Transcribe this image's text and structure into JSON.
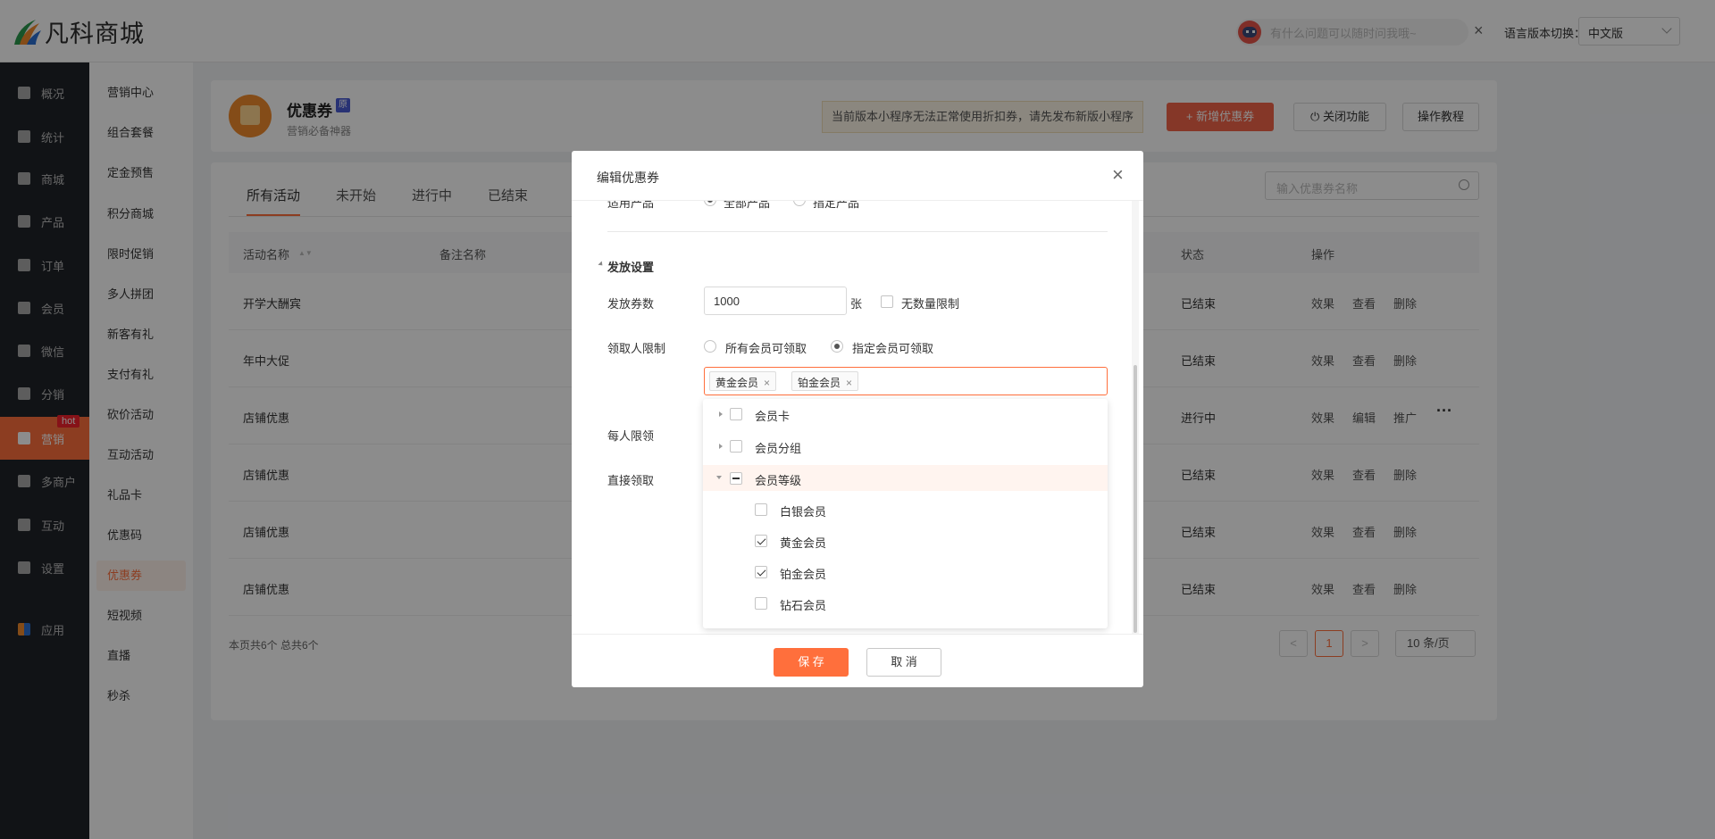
{
  "header": {
    "logo_text": "凡科商城",
    "assistant_placeholder": "有什么问题可以随时问我哦~",
    "close_glyph": "×",
    "lang_label": "语言版本切换：",
    "lang_value": "中文版"
  },
  "sidebar": {
    "items": [
      {
        "label": "概况"
      },
      {
        "label": "统计"
      },
      {
        "label": "商城"
      },
      {
        "label": "产品"
      },
      {
        "label": "订单"
      },
      {
        "label": "会员"
      },
      {
        "label": "微信"
      },
      {
        "label": "分销"
      },
      {
        "label": "营销"
      },
      {
        "label": "多商户"
      },
      {
        "label": "互动"
      },
      {
        "label": "设置"
      },
      {
        "label": "应用"
      }
    ],
    "hot_badge": "hot"
  },
  "subnav": {
    "items": [
      {
        "label": "营销中心"
      },
      {
        "label": "组合套餐"
      },
      {
        "label": "定金预售"
      },
      {
        "label": "积分商城"
      },
      {
        "label": "限时促销"
      },
      {
        "label": "多人拼团"
      },
      {
        "label": "新客有礼"
      },
      {
        "label": "支付有礼"
      },
      {
        "label": "砍价活动"
      },
      {
        "label": "互动活动"
      },
      {
        "label": "礼品卡"
      },
      {
        "label": "优惠码"
      },
      {
        "label": "优惠券"
      },
      {
        "label": "短视频"
      },
      {
        "label": "直播"
      },
      {
        "label": "秒杀"
      }
    ]
  },
  "page": {
    "title": "优惠券",
    "badge": "原",
    "subtitle": "营销必备神器",
    "warning": "当前版本小程序无法正常使用折扣券，请先发布新版小程序",
    "new_button": "+ 新增优惠券",
    "close_button": "⏻ 关闭功能",
    "help_button": "操作教程"
  },
  "tabs": [
    {
      "label": "所有活动"
    },
    {
      "label": "未开始"
    },
    {
      "label": "进行中"
    },
    {
      "label": "已结束"
    }
  ],
  "search_placeholder": "输入优惠券名称",
  "table": {
    "headers": {
      "name": "活动名称",
      "sort": "▲▼",
      "remark": "备注名称",
      "status": "状态",
      "ops": "操作"
    },
    "rows": [
      {
        "name": "开学大酬宾",
        "status": "已结束",
        "op1": "效果",
        "op2": "查看",
        "op3": "删除"
      },
      {
        "name": "年中大促",
        "status": "已结束",
        "op1": "效果",
        "op2": "查看",
        "op3": "删除"
      },
      {
        "name": "店铺优惠",
        "status": "进行中",
        "op1": "效果",
        "op2": "编辑",
        "op3": "推广",
        "more": "···"
      },
      {
        "name": "店铺优惠",
        "status": "已结束",
        "op1": "效果",
        "op2": "查看",
        "op3": "删除"
      },
      {
        "name": "店铺优惠",
        "status": "已结束",
        "op1": "效果",
        "op2": "查看",
        "op3": "删除"
      },
      {
        "name": "店铺优惠",
        "status": "已结束",
        "op1": "效果",
        "op2": "查看",
        "op3": "删除"
      }
    ],
    "footer": "本页共6个 总共6个",
    "prev": "<",
    "page": "1",
    "next": ">",
    "page_size": "10 条/页"
  },
  "modal": {
    "title": "编辑优惠券",
    "close_glyph": "×",
    "cut_label": "适用产品",
    "cut_opt1": "全部产品",
    "cut_opt2": "指定产品",
    "section": "发放设置",
    "issue_label": "发放券数",
    "issue_value": "1000",
    "issue_unit": "张",
    "unlimited": "无数量限制",
    "claim_label": "领取人限制",
    "claim_opt1": "所有会员可领取",
    "claim_opt2": "指定会员可领取",
    "tags": [
      {
        "label": "黄金会员"
      },
      {
        "label": "铂金会员"
      }
    ],
    "tag_close": "×",
    "per_limit_label": "每人限领",
    "direct_label": "直接领取",
    "tree": {
      "n1": "会员卡",
      "n2": "会员分组",
      "n3": "会员等级",
      "c1": "白银会员",
      "c2": "黄金会员",
      "c3": "铂金会员",
      "c4": "钻石会员"
    },
    "save": "保 存",
    "cancel": "取 消"
  }
}
